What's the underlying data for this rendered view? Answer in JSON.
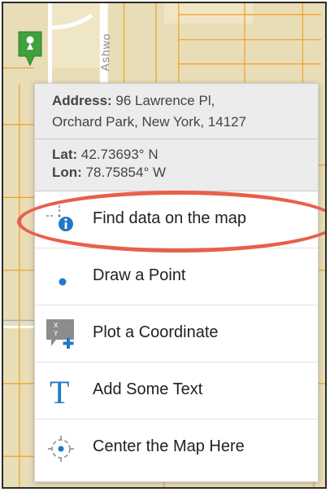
{
  "map": {
    "street_label": "Ashwo"
  },
  "popup": {
    "address_label": "Address:",
    "address_line1": "96 Lawrence Pl,",
    "address_line2": "Orchard Park, New York, 14127",
    "lat_label": "Lat:",
    "lat_value": "42.73693° N",
    "lon_label": "Lon:",
    "lon_value": "78.75854° W"
  },
  "menu": {
    "items": [
      {
        "label": "Find data on the map",
        "icon": "identify-info-icon"
      },
      {
        "label": "Draw a Point",
        "icon": "point-dot-icon"
      },
      {
        "label": "Plot a Coordinate",
        "icon": "plot-coordinate-icon"
      },
      {
        "label": "Add Some Text",
        "icon": "text-t-icon"
      },
      {
        "label": "Center the Map Here",
        "icon": "crosshair-center-icon"
      }
    ]
  },
  "colors": {
    "accent": "#1f79c7",
    "highlight": "#e8604a",
    "marker": "#3fa03c",
    "map_road": "#f0a020"
  }
}
